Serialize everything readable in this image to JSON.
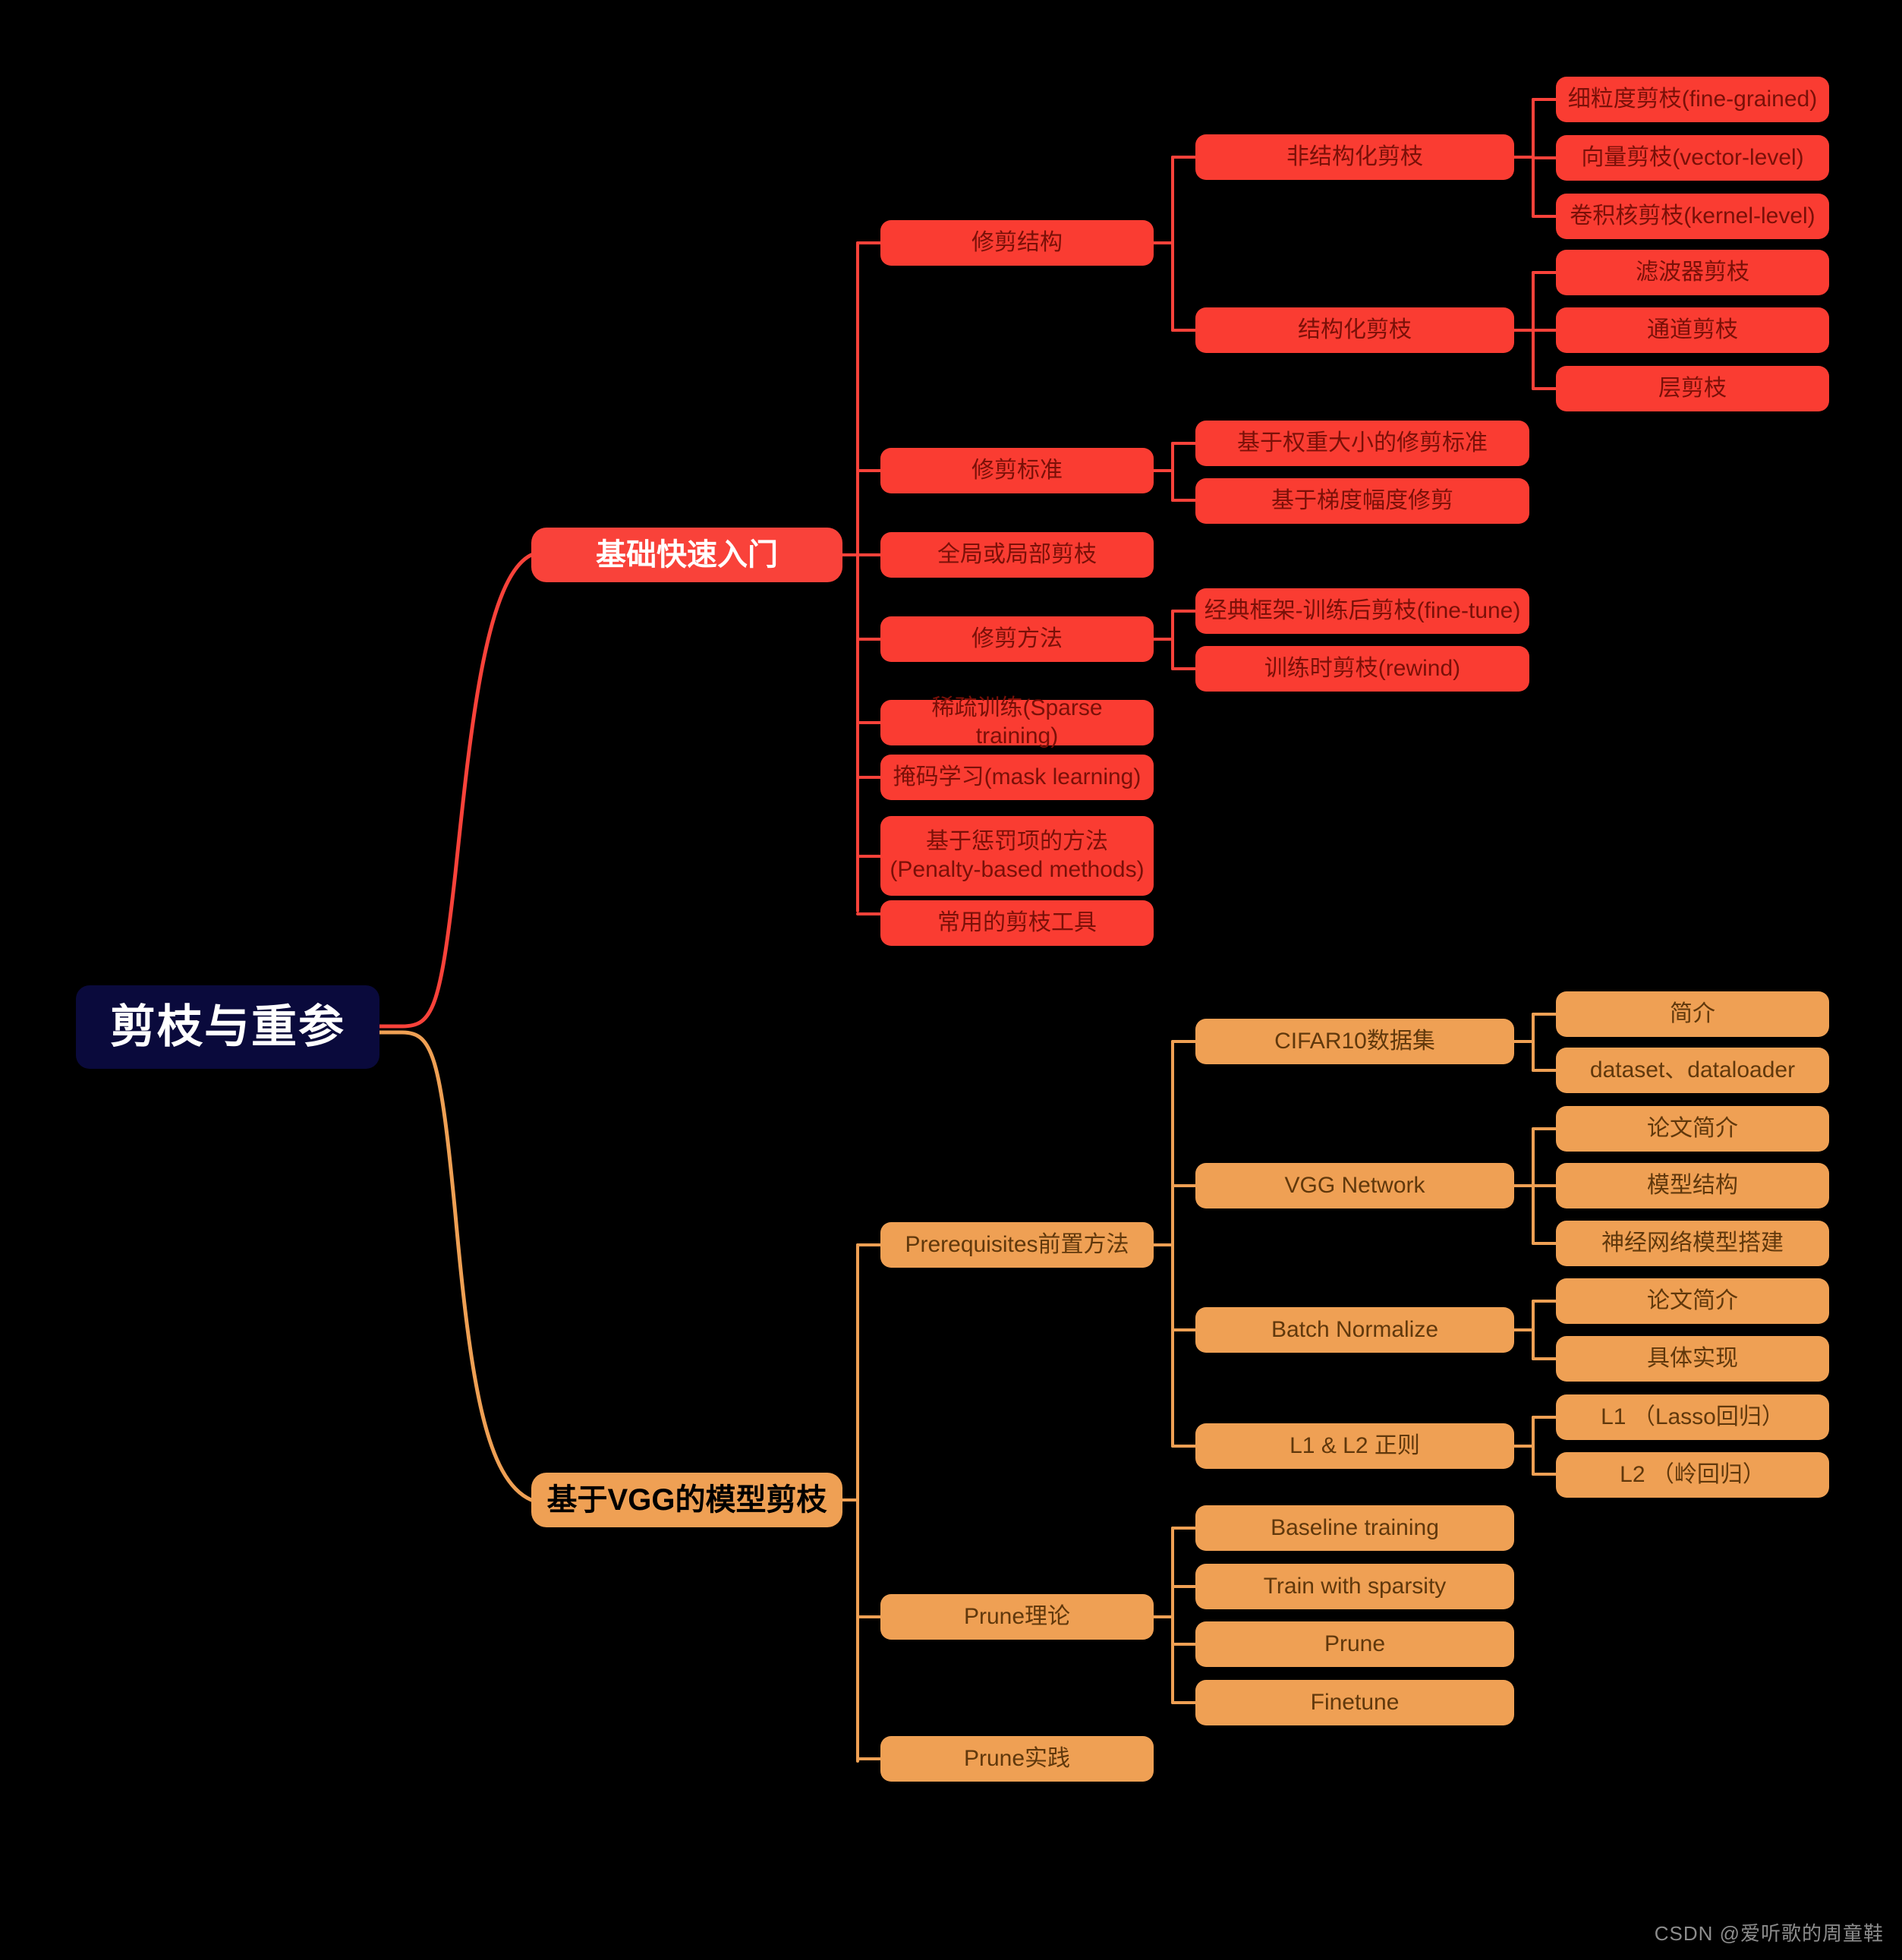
{
  "theme": {
    "background": "#000000",
    "root_fill": "#0a0a3c",
    "root_text": "#ffffff",
    "red_fill": "#fa3c32",
    "red_text": "#7a1008",
    "red_branch_fill": "#f9423a",
    "red_branch_text": "#ffffff",
    "orange_fill": "#efa054",
    "orange_text": "#60380c",
    "orange_branch_text": "#000000",
    "red_link": "#f9423a",
    "orange_link": "#efa054"
  },
  "root": {
    "label": "剪枝与重参"
  },
  "branches": [
    {
      "label": "基础快速入门",
      "color": "red",
      "children": [
        {
          "label": "修剪结构",
          "children": [
            {
              "label": "非结构化剪枝",
              "children": [
                {
                  "label": "细粒度剪枝(fine-grained)"
                },
                {
                  "label": "向量剪枝(vector-level)"
                },
                {
                  "label": "卷积核剪枝(kernel-level)"
                }
              ]
            },
            {
              "label": "结构化剪枝",
              "children": [
                {
                  "label": "滤波器剪枝"
                },
                {
                  "label": "通道剪枝"
                },
                {
                  "label": "层剪枝"
                }
              ]
            }
          ]
        },
        {
          "label": "修剪标准",
          "children": [
            {
              "label": "基于权重大小的修剪标准"
            },
            {
              "label": "基于梯度幅度修剪"
            }
          ]
        },
        {
          "label": "全局或局部剪枝",
          "children": []
        },
        {
          "label": "修剪方法",
          "children": [
            {
              "label": "经典框架-训练后剪枝(fine-tune)"
            },
            {
              "label": "训练时剪枝(rewind)"
            }
          ]
        },
        {
          "label": "稀疏训练(Sparse training)",
          "children": []
        },
        {
          "label": "掩码学习(mask learning)",
          "children": []
        },
        {
          "label": "基于惩罚项的方法\n(Penalty-based methods)",
          "children": []
        },
        {
          "label": "常用的剪枝工具",
          "children": []
        }
      ]
    },
    {
      "label": "基于VGG的模型剪枝",
      "color": "orange",
      "children": [
        {
          "label": "Prerequisites前置方法",
          "children": [
            {
              "label": "CIFAR10数据集",
              "children": [
                {
                  "label": "简介"
                },
                {
                  "label": "dataset、dataloader"
                }
              ]
            },
            {
              "label": "VGG Network",
              "children": [
                {
                  "label": "论文简介"
                },
                {
                  "label": "模型结构"
                },
                {
                  "label": "神经网络模型搭建"
                }
              ]
            },
            {
              "label": "Batch Normalize",
              "children": [
                {
                  "label": "论文简介"
                },
                {
                  "label": "具体实现"
                }
              ]
            },
            {
              "label": "L1 & L2 正则",
              "children": [
                {
                  "label": "L1 （Lasso回归）"
                },
                {
                  "label": "L2 （岭回归）"
                }
              ]
            }
          ]
        },
        {
          "label": "Prune理论",
          "children": [
            {
              "label": "Baseline training"
            },
            {
              "label": "Train with sparsity"
            },
            {
              "label": "Prune"
            },
            {
              "label": "Finetune"
            }
          ]
        },
        {
          "label": "Prune实践",
          "children": []
        }
      ]
    }
  ],
  "watermark": "CSDN @爱听歌的周童鞋"
}
